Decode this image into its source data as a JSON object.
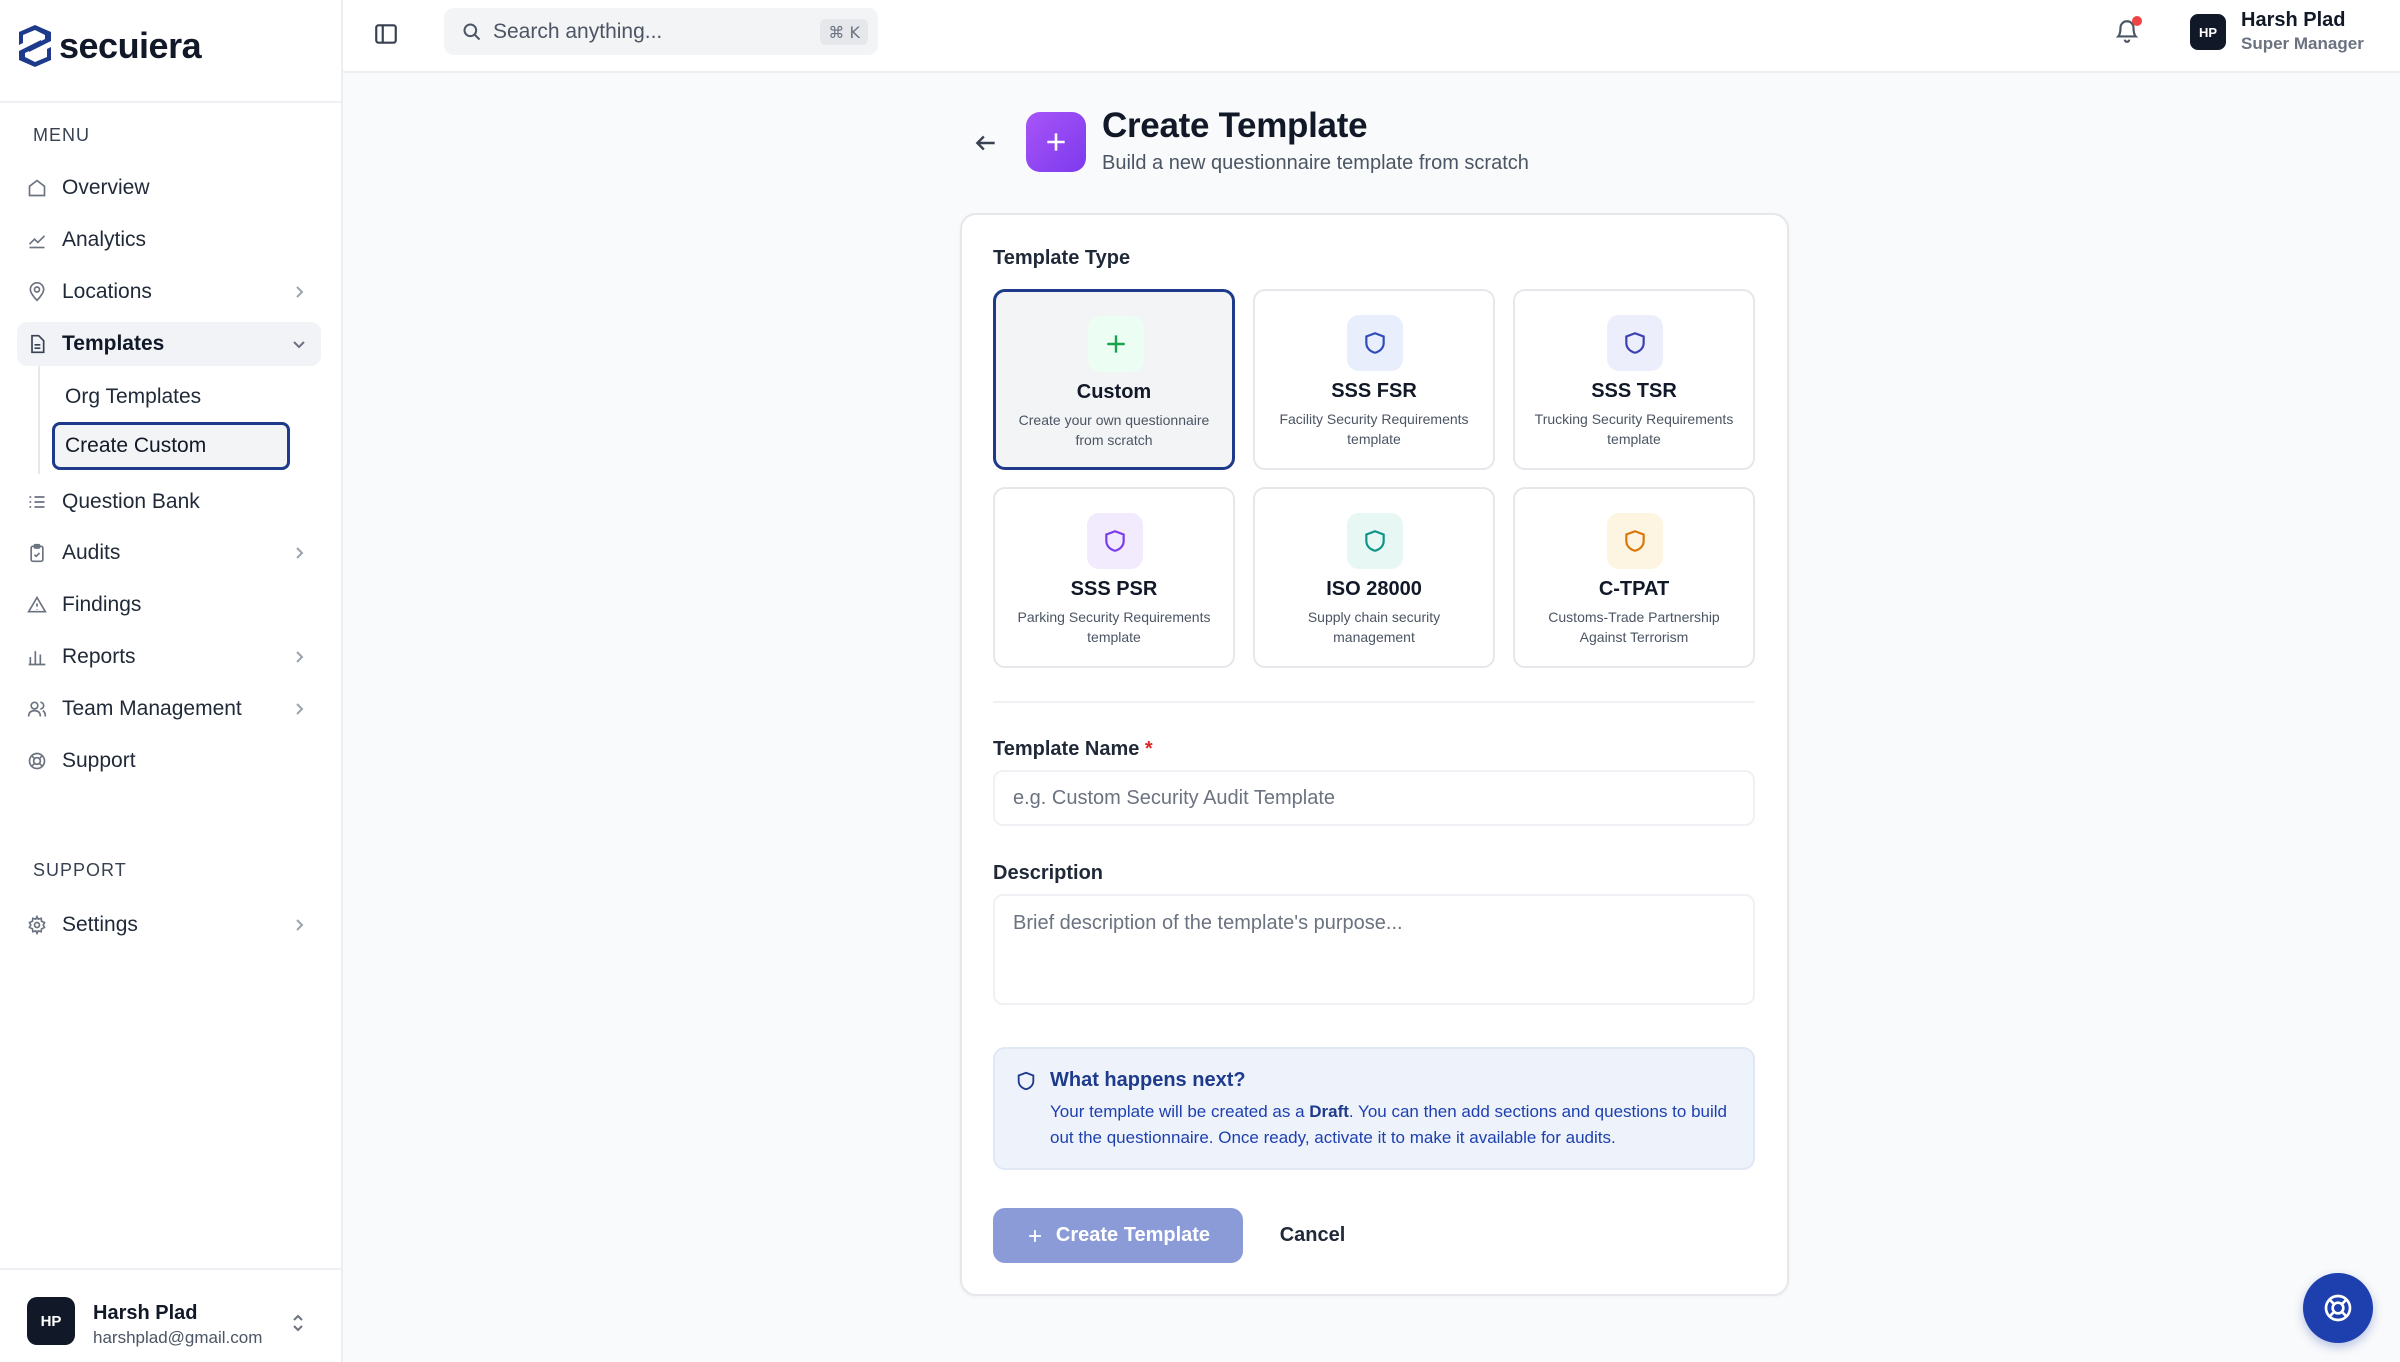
{
  "brand": {
    "name": "secuiera"
  },
  "sidebar": {
    "menu_label": "MENU",
    "support_label": "SUPPORT",
    "items": [
      {
        "label": "Overview",
        "icon": "home-icon"
      },
      {
        "label": "Analytics",
        "icon": "trend-icon"
      },
      {
        "label": "Locations",
        "icon": "map-pin-icon"
      },
      {
        "label": "Templates",
        "icon": "file-icon"
      },
      {
        "label": "Question Bank",
        "icon": "list-icon"
      },
      {
        "label": "Audits",
        "icon": "clipboard-icon"
      },
      {
        "label": "Findings",
        "icon": "warning-icon"
      },
      {
        "label": "Reports",
        "icon": "bar-chart-icon"
      },
      {
        "label": "Team Management",
        "icon": "users-icon"
      },
      {
        "label": "Support",
        "icon": "lifebuoy-icon"
      },
      {
        "label": "Settings",
        "icon": "gear-icon"
      }
    ],
    "sub_items": [
      {
        "label": "Org Templates"
      },
      {
        "label": "Create Custom"
      }
    ],
    "user": {
      "initials": "HP",
      "name": "Harsh Plad",
      "email": "harshplad@gmail.com"
    }
  },
  "topbar": {
    "search_placeholder": "Search anything...",
    "search_shortcut": "⌘ K",
    "user": {
      "initials": "HP",
      "name": "Harsh Plad",
      "role": "Super Manager"
    }
  },
  "page": {
    "title": "Create Template",
    "subtitle": "Build a new questionnaire template from scratch"
  },
  "form": {
    "template_type_label": "Template Type",
    "types": [
      {
        "title": "Custom",
        "desc": "Create your own questionnaire from scratch",
        "color": "#16a34a",
        "bg": "#ecfdf3"
      },
      {
        "title": "SSS FSR",
        "desc": "Facility Security Requirements template",
        "color": "#2f4bb8",
        "bg": "#e8eefc"
      },
      {
        "title": "SSS TSR",
        "desc": "Trucking Security Requirements template",
        "color": "#3b3fb0",
        "bg": "#eceefc"
      },
      {
        "title": "SSS PSR",
        "desc": "Parking Security Requirements template",
        "color": "#7c3aed",
        "bg": "#f1ebfd"
      },
      {
        "title": "ISO 28000",
        "desc": "Supply chain security management",
        "color": "#0d9488",
        "bg": "#e6f7f4"
      },
      {
        "title": "C-TPAT",
        "desc": "Customs-Trade Partnership Against Terrorism",
        "color": "#d97706",
        "bg": "#fdf4e2"
      }
    ],
    "name_label": "Template Name",
    "name_required_mark": "*",
    "name_placeholder": "e.g. Custom Security Audit Template",
    "description_label": "Description",
    "description_placeholder": "Brief description of the template's purpose...",
    "info_title": "What happens next?",
    "info_text_pre": "Your template will be created as a ",
    "info_text_bold": "Draft",
    "info_text_post": ". You can then add sections and questions to build out the questionnaire. Once ready, activate it to make it available for audits.",
    "submit_label": "Create Template",
    "cancel_label": "Cancel"
  },
  "colors": {
    "accent": "#1e3a8a",
    "primary_button": "#8a9bd8",
    "header_icon": "#9333ea",
    "notification_dot": "#ef4444"
  }
}
